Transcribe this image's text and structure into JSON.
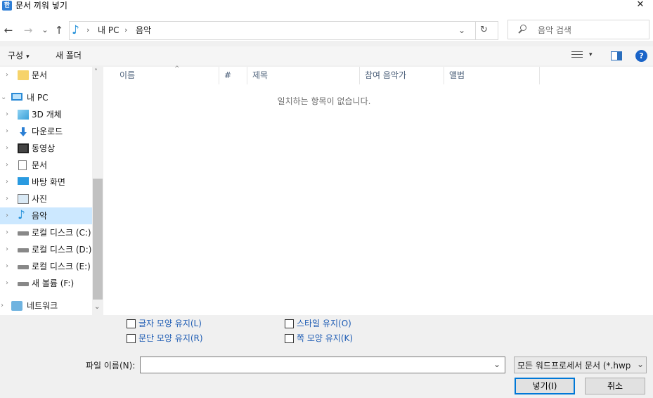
{
  "window": {
    "app_icon": "hwp-app-icon",
    "app_icon_glyph": "한",
    "title": "문서 끼워 넣기",
    "close_glyph": "✕"
  },
  "navbar": {
    "back_glyph": "←",
    "forward_glyph": "→",
    "recent_glyph": "⌄",
    "up_glyph": "↑",
    "address": {
      "icon": "music-note-icon",
      "icon_glyph": "♪",
      "sep_glyph": "›",
      "segments": [
        "내 PC",
        "음악"
      ],
      "dropdown_glyph": "⌄",
      "refresh_glyph": "↻"
    },
    "search": {
      "placeholder": "음악 검색"
    }
  },
  "toolbar": {
    "organize_label": "구성",
    "caret_glyph": "▾",
    "new_folder_label": "새 폴더",
    "help_glyph": "?"
  },
  "nav_pane": {
    "chevron_right": "›",
    "chevron_down": "⌄",
    "items": [
      {
        "label": "문서",
        "icon": "folder-icon"
      },
      {
        "label": "내 PC",
        "icon": "computer-icon"
      },
      {
        "label": "3D 개체",
        "icon": "cube-3d-icon"
      },
      {
        "label": "다운로드",
        "icon": "download-arrow-icon"
      },
      {
        "label": "동영상",
        "icon": "film-icon"
      },
      {
        "label": "문서",
        "icon": "document-icon"
      },
      {
        "label": "바탕 화면",
        "icon": "desktop-icon"
      },
      {
        "label": "사진",
        "icon": "pictures-icon"
      },
      {
        "label": "음악",
        "icon": "music-note-icon",
        "selected": true
      },
      {
        "label": "로컬 디스크 (C:)",
        "icon": "drive-c-icon"
      },
      {
        "label": "로컬 디스크 (D:)",
        "icon": "drive-icon"
      },
      {
        "label": "로컬 디스크 (E:)",
        "icon": "drive-icon"
      },
      {
        "label": "새 볼륨 (F:)",
        "icon": "drive-icon"
      },
      {
        "label": "네트워크",
        "icon": "network-icon"
      }
    ],
    "scroll_up_glyph": "˄",
    "scroll_down_glyph": "⌄"
  },
  "file_list": {
    "columns": [
      "이름",
      "#",
      "제목",
      "참여 음악가",
      "앨범"
    ],
    "sort_glyph": "^",
    "empty_message": "일치하는 항목이 없습니다."
  },
  "options": {
    "keep_char_shape": "글자 모양 유지(L)",
    "keep_para_shape": "문단 모양 유지(R)",
    "keep_style": "스타일 유지(O)",
    "keep_page_shape": "쪽 모양 유지(K)"
  },
  "footer": {
    "filename_label": "파일 이름(N):",
    "filename_value": "",
    "filename_dd_glyph": "⌄",
    "filetype_value": "모든 워드프로세서 문서 (*.hwp",
    "filetype_dd_glyph": "⌄",
    "insert_button": "넣기(I)",
    "cancel_button": "취소"
  }
}
